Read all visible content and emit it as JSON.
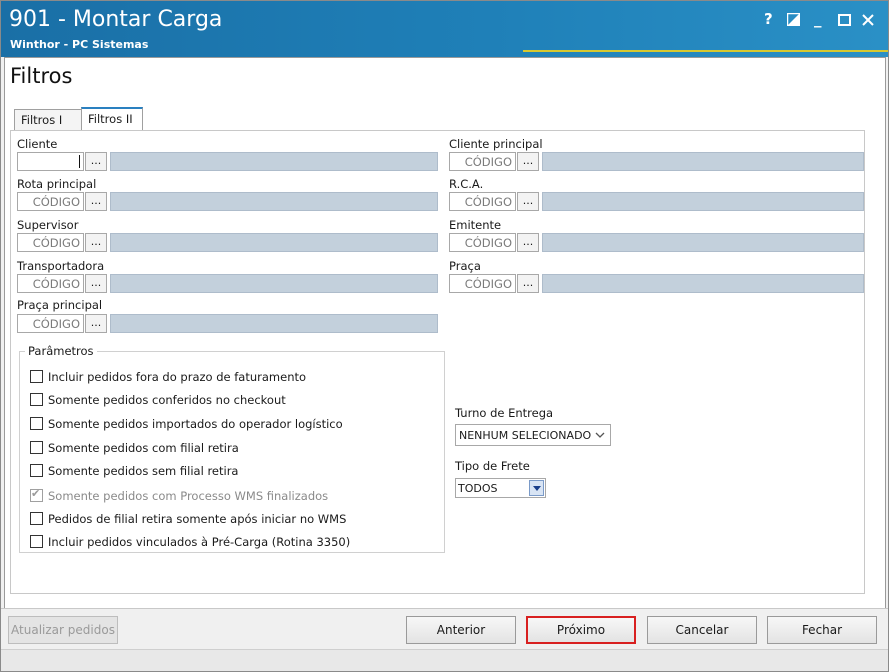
{
  "window": {
    "title": "901 - Montar Carga",
    "subtitle": "Winthor - PC Sistemas",
    "controls": {
      "help": "?",
      "minimize": "_"
    }
  },
  "page": {
    "title": "Filtros"
  },
  "tabs": [
    {
      "label": "Filtros I",
      "active": false
    },
    {
      "label": "Filtros II",
      "active": true
    }
  ],
  "left_fields": [
    {
      "label": "Cliente",
      "code": "",
      "dots": "...",
      "description": ""
    },
    {
      "label": "Rota principal",
      "code": "CÓDIGO",
      "dots": "...",
      "description": ""
    },
    {
      "label": "Supervisor",
      "code": "CÓDIGO",
      "dots": "...",
      "description": ""
    },
    {
      "label": "Transportadora",
      "code": "CÓDIGO",
      "dots": "...",
      "description": ""
    },
    {
      "label": "Praça principal",
      "code": "CÓDIGO",
      "dots": "...",
      "description": ""
    }
  ],
  "right_fields": [
    {
      "label": "Cliente principal",
      "code": "CÓDIGO",
      "dots": "...",
      "description": ""
    },
    {
      "label": "R.C.A.",
      "code": "CÓDIGO",
      "dots": "...",
      "description": ""
    },
    {
      "label": "Emitente",
      "code": "CÓDIGO",
      "dots": "...",
      "description": ""
    },
    {
      "label": "Praça",
      "code": "CÓDIGO",
      "dots": "...",
      "description": ""
    }
  ],
  "parametros": {
    "title": "Parâmetros",
    "options": [
      {
        "label": "Incluir pedidos fora do prazo de faturamento",
        "checked": false,
        "disabled": false
      },
      {
        "label": "Somente pedidos conferidos no checkout",
        "checked": false,
        "disabled": false
      },
      {
        "label": "Somente pedidos importados do operador logístico",
        "checked": false,
        "disabled": false
      },
      {
        "label": "Somente pedidos com filial retira",
        "checked": false,
        "disabled": false
      },
      {
        "label": "Somente pedidos sem filial retira",
        "checked": false,
        "disabled": false
      },
      {
        "label": "Somente pedidos com Processo WMS finalizados",
        "checked": true,
        "disabled": true
      },
      {
        "label": "Pedidos de filial retira somente após iniciar no WMS",
        "checked": false,
        "disabled": false
      },
      {
        "label": "Incluir pedidos vinculados à Pré-Carga (Rotina 3350)",
        "checked": false,
        "disabled": false
      }
    ]
  },
  "turno_entrega": {
    "label": "Turno de Entrega",
    "value": "NENHUM SELECIONADO"
  },
  "tipo_frete": {
    "label": "Tipo de Frete",
    "value": "TODOS"
  },
  "buttons": {
    "atualizar": "Atualizar pedidos",
    "anterior": "Anterior",
    "proximo": "Próximo",
    "cancelar": "Cancelar",
    "fechar": "Fechar"
  },
  "colors": {
    "titlebar": "#1f80b8",
    "field_desc_bg": "#c3d0dc",
    "highlight_border": "#d82020",
    "dropdown_arrow_bg": "#2a6fd0"
  }
}
